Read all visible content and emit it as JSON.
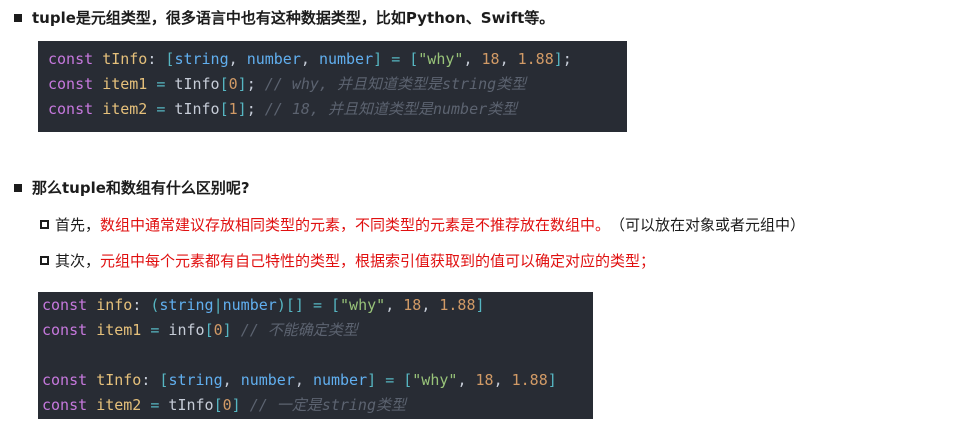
{
  "heading1": "tuple是元组类型，很多语言中也有这种数据类型，比如Python、Swift等。",
  "code1": [
    [
      [
        "kw",
        "const"
      ],
      [
        "pl",
        " "
      ],
      [
        "id",
        "tInfo"
      ],
      [
        "pl",
        ": "
      ],
      [
        "op",
        "["
      ],
      [
        "ty",
        "string"
      ],
      [
        "pl",
        ", "
      ],
      [
        "ty",
        "number"
      ],
      [
        "pl",
        ", "
      ],
      [
        "ty",
        "number"
      ],
      [
        "op",
        "]"
      ],
      [
        "pl",
        " "
      ],
      [
        "op",
        "="
      ],
      [
        "pl",
        " "
      ],
      [
        "op",
        "["
      ],
      [
        "st",
        "\"why\""
      ],
      [
        "pl",
        ", "
      ],
      [
        "nm",
        "18"
      ],
      [
        "pl",
        ", "
      ],
      [
        "nm",
        "1.88"
      ],
      [
        "op",
        "]"
      ],
      [
        "pl",
        ";"
      ]
    ],
    [
      [
        "kw",
        "const"
      ],
      [
        "pl",
        " "
      ],
      [
        "id",
        "item1"
      ],
      [
        "pl",
        " "
      ],
      [
        "op",
        "="
      ],
      [
        "pl",
        " tInfo"
      ],
      [
        "op",
        "["
      ],
      [
        "nm",
        "0"
      ],
      [
        "op",
        "]"
      ],
      [
        "pl",
        "; "
      ],
      [
        "cm",
        "// why, 并且知道类型是string类型"
      ]
    ],
    [
      [
        "kw",
        "const"
      ],
      [
        "pl",
        " "
      ],
      [
        "id",
        "item2"
      ],
      [
        "pl",
        " "
      ],
      [
        "op",
        "="
      ],
      [
        "pl",
        " tInfo"
      ],
      [
        "op",
        "["
      ],
      [
        "nm",
        "1"
      ],
      [
        "op",
        "]"
      ],
      [
        "pl",
        "; "
      ],
      [
        "cm",
        "// 18, 并且知道类型是number类型"
      ]
    ]
  ],
  "heading2": "那么tuple和数组有什么区别呢?",
  "point1": {
    "prefix": "首先，",
    "red": "数组中通常建议存放相同类型的元素，不同类型的元素是不推荐放在数组中。",
    "suffix": "（可以放在对象或者元组中）"
  },
  "point2": {
    "prefix": "其次，",
    "red": "元组中每个元素都有自己特性的类型，根据索引值获取到的值可以确定对应的类型；"
  },
  "code2": [
    [
      [
        "kw",
        "const"
      ],
      [
        "pl",
        " "
      ],
      [
        "id",
        "info"
      ],
      [
        "pl",
        ": "
      ],
      [
        "op",
        "("
      ],
      [
        "ty",
        "string"
      ],
      [
        "op",
        "|"
      ],
      [
        "ty",
        "number"
      ],
      [
        "op",
        ")[]"
      ],
      [
        "pl",
        " "
      ],
      [
        "op",
        "="
      ],
      [
        "pl",
        " "
      ],
      [
        "op",
        "["
      ],
      [
        "st",
        "\"why\""
      ],
      [
        "pl",
        ", "
      ],
      [
        "nm",
        "18"
      ],
      [
        "pl",
        ", "
      ],
      [
        "nm",
        "1.88"
      ],
      [
        "op",
        "]"
      ]
    ],
    [
      [
        "kw",
        "const"
      ],
      [
        "pl",
        " "
      ],
      [
        "id",
        "item1"
      ],
      [
        "pl",
        " "
      ],
      [
        "op",
        "="
      ],
      [
        "pl",
        " info"
      ],
      [
        "op",
        "["
      ],
      [
        "nm",
        "0"
      ],
      [
        "op",
        "]"
      ],
      [
        "pl",
        " "
      ],
      [
        "cm",
        "// 不能确定类型"
      ]
    ],
    [],
    [
      [
        "kw",
        "const"
      ],
      [
        "pl",
        " "
      ],
      [
        "id",
        "tInfo"
      ],
      [
        "pl",
        ": "
      ],
      [
        "op",
        "["
      ],
      [
        "ty",
        "string"
      ],
      [
        "pl",
        ", "
      ],
      [
        "ty",
        "number"
      ],
      [
        "pl",
        ", "
      ],
      [
        "ty",
        "number"
      ],
      [
        "op",
        "]"
      ],
      [
        "pl",
        " "
      ],
      [
        "op",
        "="
      ],
      [
        "pl",
        " "
      ],
      [
        "op",
        "["
      ],
      [
        "st",
        "\"why\""
      ],
      [
        "pl",
        ", "
      ],
      [
        "nm",
        "18"
      ],
      [
        "pl",
        ", "
      ],
      [
        "nm",
        "1.88"
      ],
      [
        "op",
        "]"
      ]
    ],
    [
      [
        "kw",
        "const"
      ],
      [
        "pl",
        " "
      ],
      [
        "id",
        "item2"
      ],
      [
        "pl",
        " "
      ],
      [
        "op",
        "="
      ],
      [
        "pl",
        " tInfo"
      ],
      [
        "op",
        "["
      ],
      [
        "nm",
        "0"
      ],
      [
        "op",
        "]"
      ],
      [
        "pl",
        " "
      ],
      [
        "cm",
        "// 一定是string类型"
      ]
    ]
  ]
}
